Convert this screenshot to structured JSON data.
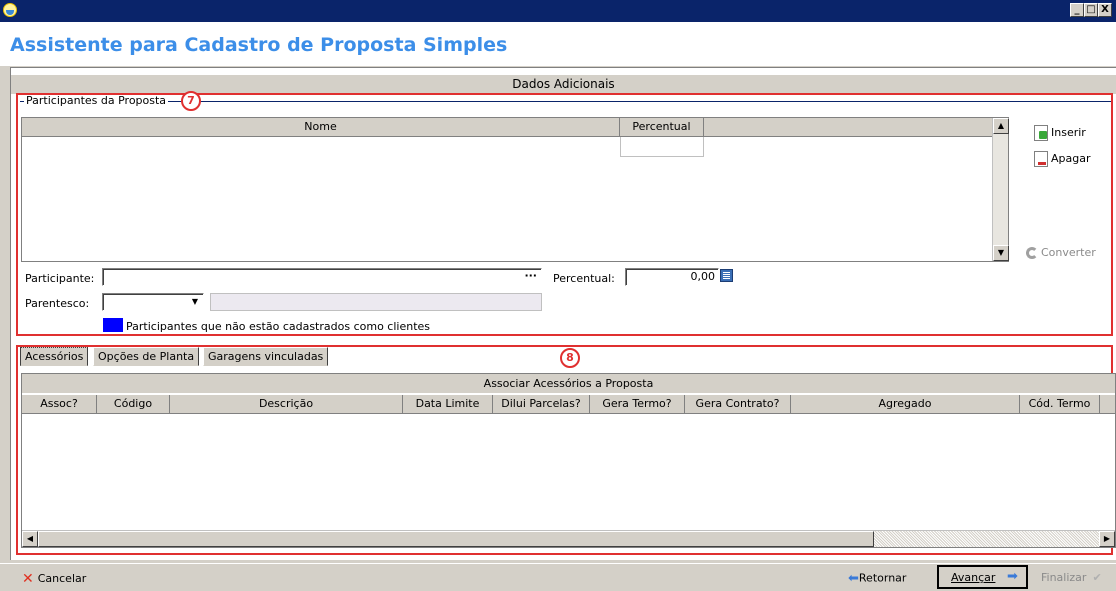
{
  "window": {
    "title": "Assistente para Cadastro de Proposta Simples",
    "controls": [
      "_",
      "□",
      "X"
    ]
  },
  "section_title": "Dados Adicionais",
  "participants": {
    "group_label": "Participantes da Proposta",
    "marker": "7",
    "columns": [
      "Nome",
      "Percentual"
    ],
    "rows": [],
    "buttons": {
      "insert": "Inserir",
      "delete": "Apagar",
      "convert": "Converter"
    },
    "participant_label": "Participante:",
    "participant_value": "",
    "ellipsis": "···",
    "percentual_label": "Percentual:",
    "percentual_value": "0,00",
    "parentesco_label": "Parentesco:",
    "parentesco_value": "",
    "legend_text": "Participantes que não estão cadastrados como clientes",
    "legend_color": "#0000ff"
  },
  "tabs": {
    "marker": "8",
    "items": [
      {
        "label": "Acessórios",
        "active": true
      },
      {
        "label": "Opções de Planta",
        "active": false
      },
      {
        "label": "Garagens vinculadas",
        "active": false
      }
    ]
  },
  "accessories": {
    "title": "Associar Acessórios a Proposta",
    "columns": [
      "Assoc?",
      "Código",
      "Descrição",
      "Data Limite",
      "Dilui Parcelas?",
      "Gera Termo?",
      "Gera Contrato?",
      "Agregado",
      "Cód. Termo"
    ],
    "rows": []
  },
  "footer": {
    "cancel": "Cancelar",
    "back": "Retornar",
    "next": "Avançar",
    "finish": "Finalizar"
  },
  "colors": {
    "title_blue": "#3c8ee8",
    "titlebar": "#0a246a",
    "highlight_red": "#e03030"
  }
}
